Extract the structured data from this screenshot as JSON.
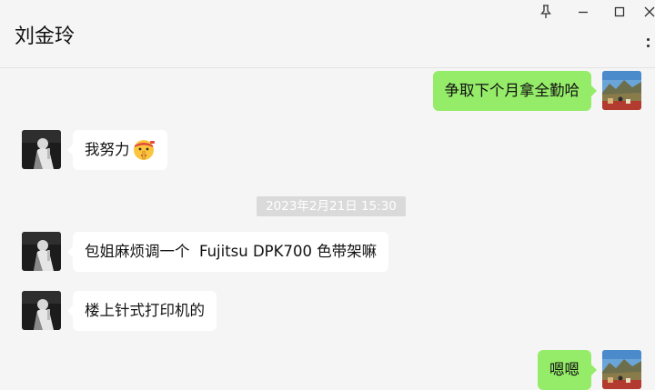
{
  "header": {
    "title": "刘金玲"
  },
  "icons": {
    "pin": "pin-icon",
    "minimize": "minimize-icon",
    "maximize": "maximize-icon",
    "close": "close-icon",
    "more": "more-icon",
    "emoji": "shushing-face-emoji"
  },
  "colors": {
    "background": "#f5f5f5",
    "outgoing_bubble": "#95ec69",
    "incoming_bubble": "#ffffff",
    "timestamp_bg": "#dadada"
  },
  "messages": [
    {
      "direction": "out",
      "text": "争取下个月拿全勤哈"
    },
    {
      "direction": "in",
      "text": "我努力"
    },
    {
      "type": "timestamp",
      "text": "2023年2月21日 15:30"
    },
    {
      "direction": "in",
      "text": "包姐麻烦调一个  Fujitsu DPK700 色带架嘛"
    },
    {
      "direction": "in",
      "text": "楼上针式打印机的"
    },
    {
      "direction": "out",
      "text": "嗯嗯"
    }
  ]
}
